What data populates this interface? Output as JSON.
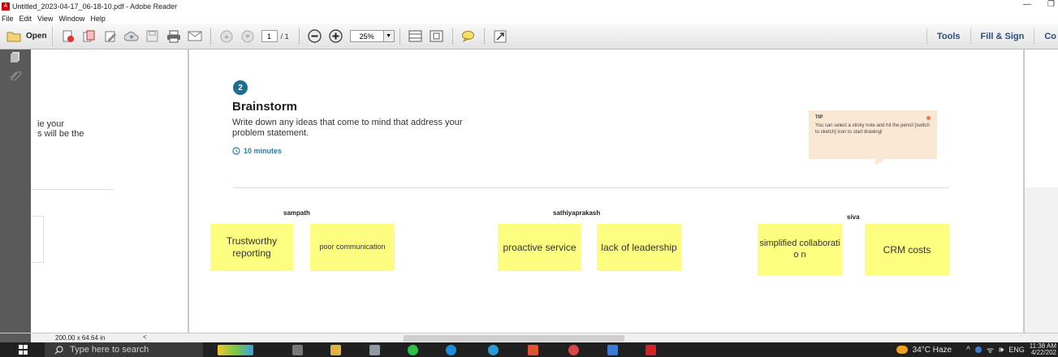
{
  "window": {
    "title": "Untitled_2023-04-17_06-18-10.pdf - Adobe Reader",
    "minimize": "—",
    "restore": "❐"
  },
  "menu": [
    "File",
    "Edit",
    "View",
    "Window",
    "Help"
  ],
  "toolbar": {
    "open_label": "Open",
    "page_current": "1",
    "page_total": "/ 1",
    "zoom": "25%",
    "right_tabs": [
      "Tools",
      "Fill & Sign",
      "Co"
    ]
  },
  "left_panel": {
    "cut_lines": [
      "ie your",
      "s will be the"
    ]
  },
  "document": {
    "step_number": "2",
    "title": "Brainstorm",
    "description": "Write down any ideas that come to mind that address your problem statement.",
    "timer": "10 minutes",
    "tip": {
      "title": "TIP",
      "text": "You can select a sticky note and hit the pencil [switch to sketch] icon to start drawing!"
    },
    "participants": [
      {
        "name": "sampath",
        "notes": [
          "Trustworthy reporting",
          "poor communication"
        ]
      },
      {
        "name": "sathiyaprakash",
        "notes": [
          "proactive service",
          "lack of leadership"
        ]
      },
      {
        "name": "siva",
        "notes": [
          "simplified collaboratio n",
          "CRM costs"
        ]
      }
    ]
  },
  "status": {
    "page_size": "200.00 x 64.64 in",
    "scroll_left": "<"
  },
  "taskbar": {
    "search_placeholder": "Type here to search",
    "weather": "34°C Haze",
    "language": "ENG",
    "time": "11:38 AM",
    "date": "4/22/202"
  },
  "colors": {
    "sticky": "#fdfd80",
    "accent": "#1d6f90",
    "tip_bg": "#fbe8d4",
    "nav_dark": "#5a5a5a"
  }
}
